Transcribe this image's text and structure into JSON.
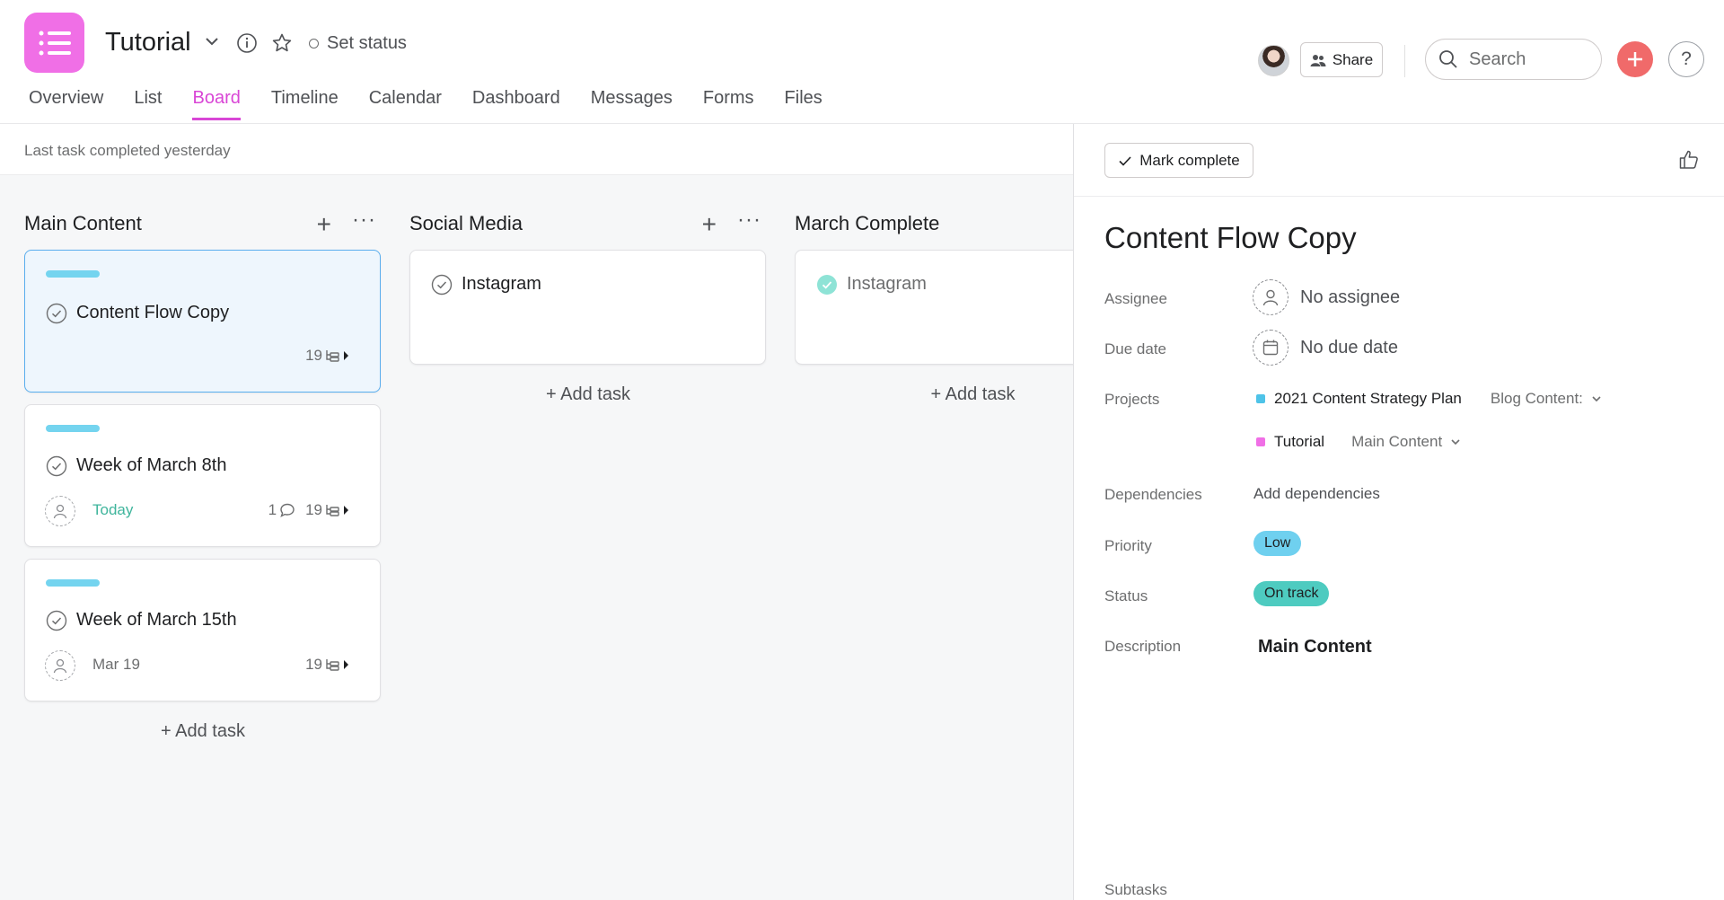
{
  "header": {
    "project_title": "Tutorial",
    "set_status": "Set status",
    "share_label": "Share",
    "search_placeholder": "Search",
    "help_label": "?",
    "tabs": [
      "Overview",
      "List",
      "Board",
      "Timeline",
      "Calendar",
      "Dashboard",
      "Messages",
      "Forms",
      "Files"
    ],
    "active_tab": "Board",
    "brand_color": "#f06fe6",
    "add_color": "#f06a6a"
  },
  "board": {
    "status_text": "Last task completed yesterday",
    "add_task_label": "+ Add task",
    "columns": [
      {
        "title": "Main Content",
        "cards": [
          {
            "name": "Content Flow Copy",
            "due": "",
            "comments": "",
            "subtasks": "19",
            "selected": true
          },
          {
            "name": "Week of March 8th",
            "due": "Today",
            "comments": "1",
            "subtasks": "19"
          },
          {
            "name": "Week of March 15th",
            "due": "Mar 19",
            "comments": "",
            "subtasks": "19"
          }
        ]
      },
      {
        "title": "Social Media",
        "cards": [
          {
            "name": "Instagram"
          }
        ]
      },
      {
        "title": "March Complete",
        "cards": [
          {
            "name": "Instagram",
            "completed": true
          }
        ]
      }
    ]
  },
  "detail": {
    "mark_complete": "Mark complete",
    "title": "Content Flow Copy",
    "labels": {
      "assignee": "Assignee",
      "due_date": "Due date",
      "projects": "Projects",
      "dependencies": "Dependencies",
      "priority": "Priority",
      "status": "Status",
      "description": "Description",
      "subtasks": "Subtasks"
    },
    "assignee": "No assignee",
    "due_date": "No due date",
    "projects": [
      {
        "name": "2021 Content Strategy Plan",
        "section": "Blog Content:",
        "color": "#4ec3e8"
      },
      {
        "name": "Tutorial",
        "section": "Main Content",
        "color": "#f06fe6"
      }
    ],
    "dependencies": "Add dependencies",
    "priority": "Low",
    "priority_color": "#6fd0ef",
    "status": "On track",
    "status_color": "#4ecbc0",
    "description": "Main Content"
  }
}
